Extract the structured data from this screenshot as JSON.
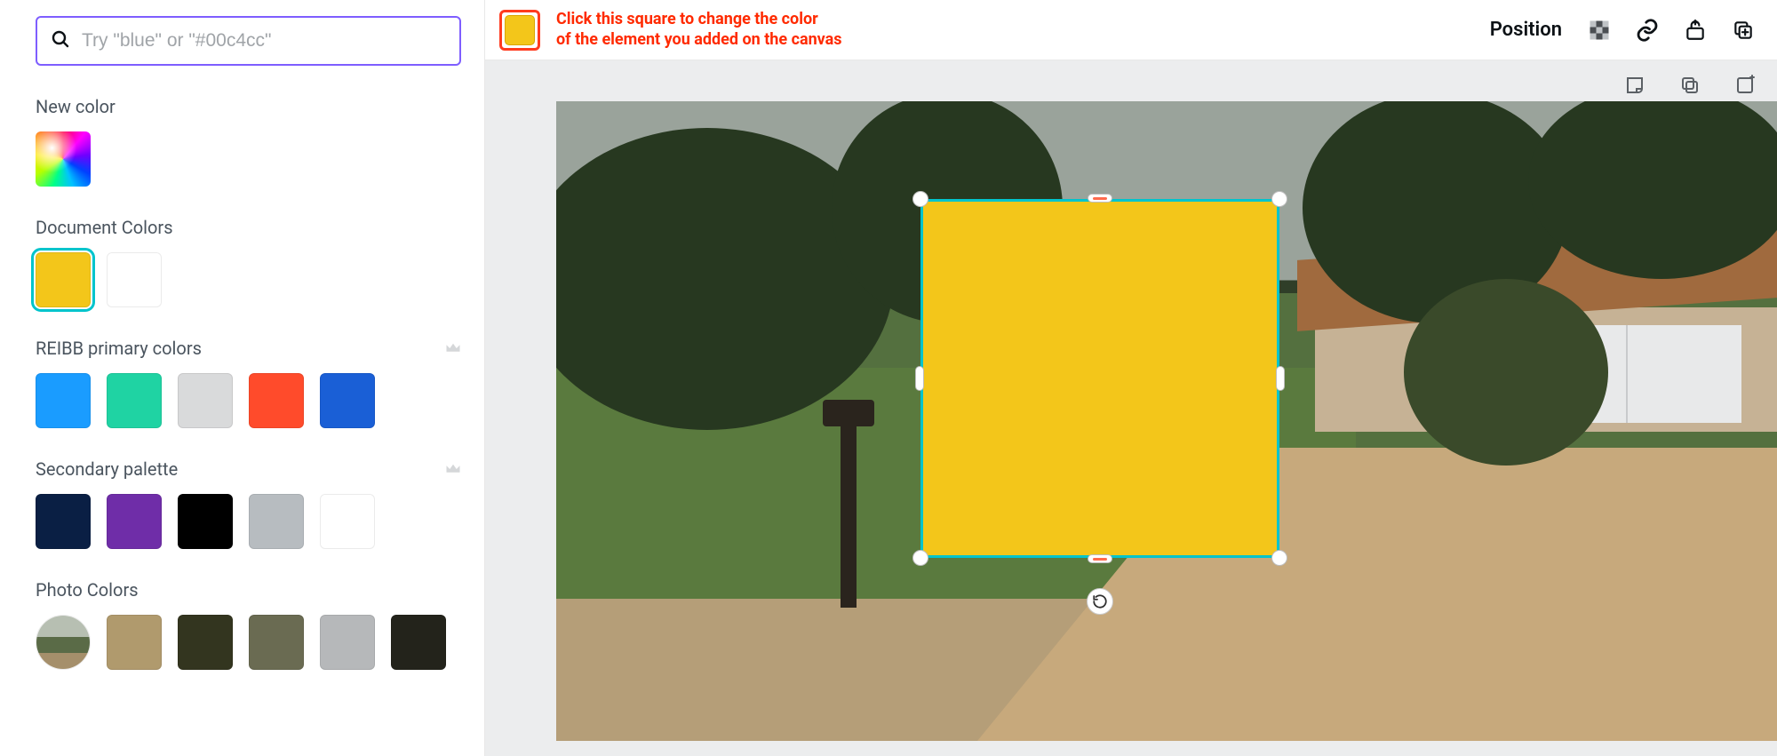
{
  "sidebar": {
    "search_placeholder": "Try \"blue\" or \"#00c4cc\"",
    "new_color_label": "New color",
    "document_colors_label": "Document Colors",
    "document_colors": [
      "#f3c61a",
      "#ffffff"
    ],
    "document_selected_index": 0,
    "brand1_label": "REIBB primary colors",
    "brand1_colors": [
      "#1a9cff",
      "#1fd3a3",
      "#d9dadb",
      "#ff4b2b",
      "#1a5fd6"
    ],
    "brand2_label": "Secondary palette",
    "brand2_colors": [
      "#0a1f44",
      "#6f2da8",
      "#000000",
      "#b7bcc0",
      "#ffffff"
    ],
    "photo_label": "Photo Colors",
    "photo_colors": [
      "#b09a6d",
      "#33351f",
      "#6a6b52",
      "#b6b8ba",
      "#23231b"
    ]
  },
  "toolbar": {
    "current_fill": "#f3c61a",
    "annotation_line1": "Click this square to change the color",
    "annotation_line2": "of the element you added on the canvas",
    "position_label": "Position"
  },
  "canvas": {
    "element_fill": "#f3c61a",
    "selection_color": "#00c4cc"
  }
}
